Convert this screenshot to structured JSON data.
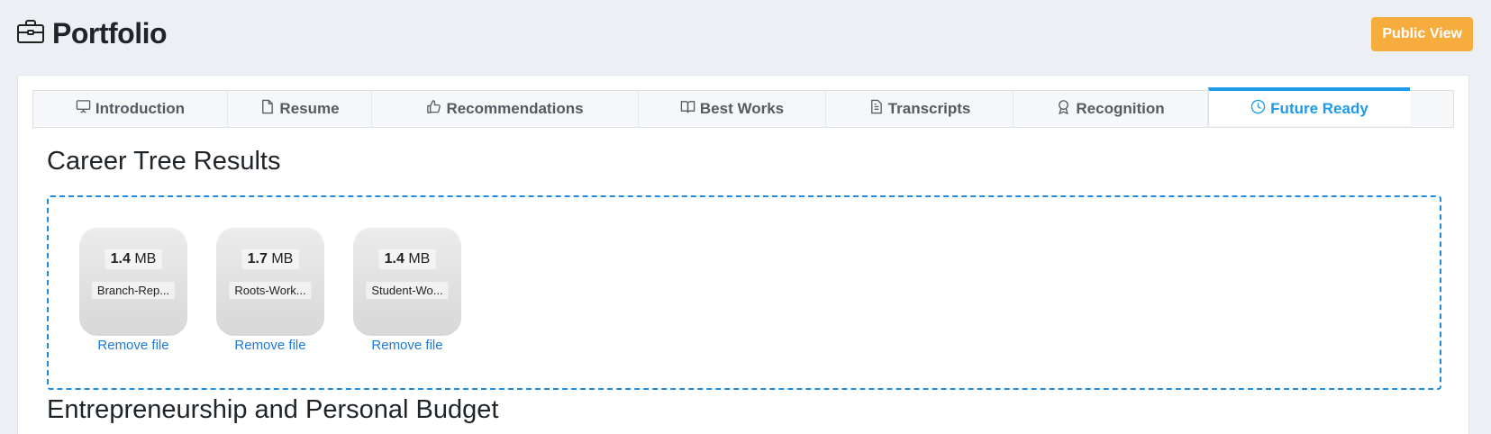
{
  "header": {
    "title": "Portfolio",
    "title_icon": "briefcase-icon",
    "public_view_label": "Public View"
  },
  "tabs": [
    {
      "label": "Introduction",
      "icon": "presentation-icon",
      "active": false
    },
    {
      "label": "Resume",
      "icon": "document-icon",
      "active": false
    },
    {
      "label": "Recommendations",
      "icon": "thumbs-up-icon",
      "active": false
    },
    {
      "label": "Best Works",
      "icon": "book-icon",
      "active": false
    },
    {
      "label": "Transcripts",
      "icon": "file-text-icon",
      "active": false
    },
    {
      "label": "Recognition",
      "icon": "award-icon",
      "active": false
    },
    {
      "label": "Future Ready",
      "icon": "clock-icon",
      "active": true
    }
  ],
  "sections": {
    "career_tree_title": "Career Tree Results",
    "entrepreneurship_title": "Entrepreneurship and Personal Budget"
  },
  "files": [
    {
      "size_value": "1.4",
      "size_unit": "MB",
      "name": "Branch-Rep...",
      "remove_label": "Remove file"
    },
    {
      "size_value": "1.7",
      "size_unit": "MB",
      "name": "Roots-Work...",
      "remove_label": "Remove file"
    },
    {
      "size_value": "1.4",
      "size_unit": "MB",
      "name": "Student-Wo...",
      "remove_label": "Remove file"
    }
  ],
  "colors": {
    "accent": "#1e9be8",
    "public_view_button": "#f7ac3e",
    "dropzone_border": "#1e8be0",
    "link": "#1e7ad6"
  }
}
